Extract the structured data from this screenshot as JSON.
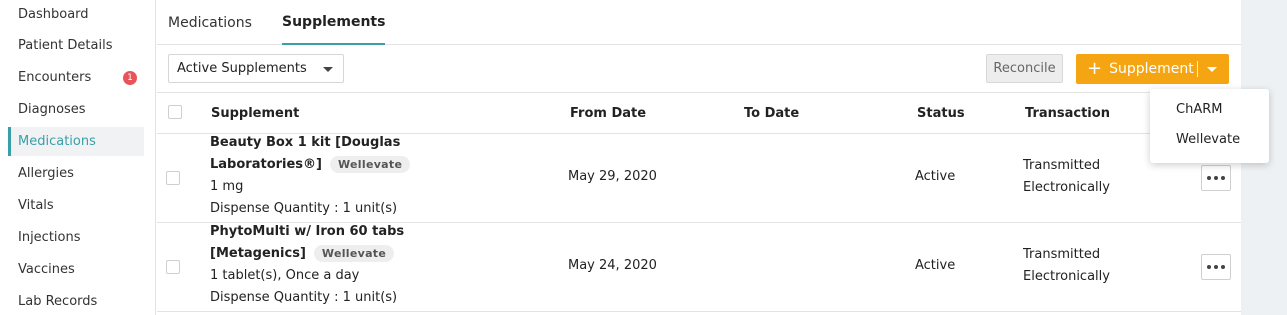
{
  "sidebar": {
    "items": [
      {
        "label": "Dashboard"
      },
      {
        "label": "Patient Details"
      },
      {
        "label": "Encounters",
        "badge": "1"
      },
      {
        "label": "Diagnoses"
      },
      {
        "label": "Medications"
      },
      {
        "label": "Allergies"
      },
      {
        "label": "Vitals"
      },
      {
        "label": "Injections"
      },
      {
        "label": "Vaccines"
      },
      {
        "label": "Lab Records"
      }
    ],
    "active": "Medications"
  },
  "tabs": [
    {
      "label": "Medications"
    },
    {
      "label": "Supplements"
    }
  ],
  "filter": {
    "selected": "Active Supplements"
  },
  "toolbar": {
    "reconcile_label": "Reconcile",
    "add_supplement_label": "Supplement"
  },
  "add_menu": {
    "items": [
      "ChARM",
      "Wellevate"
    ]
  },
  "table": {
    "headers": {
      "supplement": "Supplement",
      "from_date": "From Date",
      "to_date": "To Date",
      "status": "Status",
      "transaction": "Transaction"
    },
    "rows": [
      {
        "name_line1": "Beauty Box 1 kit   [Douglas",
        "name_line2": "Laboratories®]",
        "tag": "Wellevate",
        "dosage": "1 mg",
        "dispense": "Dispense Quantity : 1 unit(s)",
        "from_date": "May 29, 2020",
        "to_date": "",
        "status": "Active",
        "transaction_line1": "Transmitted",
        "transaction_line2": "Electronically"
      },
      {
        "name_line1": "PhytoMulti w/ Iron 60 tabs",
        "name_line2": "[Metagenics]",
        "tag": "Wellevate",
        "dosage": "1 tablet(s), Once a day",
        "dispense": "Dispense Quantity : 1 unit(s)",
        "from_date": "May 24, 2020",
        "to_date": "",
        "status": "Active",
        "transaction_line1": "Transmitted",
        "transaction_line2": "Electronically"
      }
    ]
  },
  "colors": {
    "accent": "#3a9fa8",
    "primary_button": "#f5a511",
    "badge": "#e9545a"
  }
}
